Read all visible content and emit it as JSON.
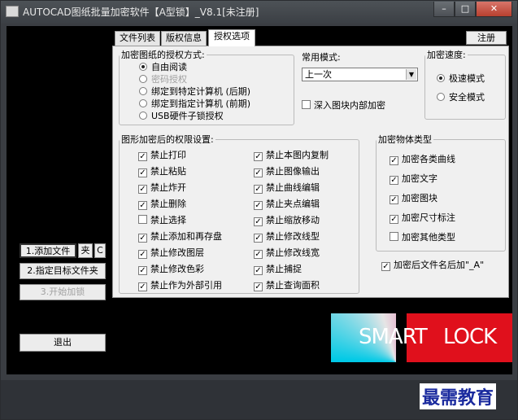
{
  "window": {
    "title": "AUTOCAD图纸批量加密软件【A型锁】_V8.1[未注册]",
    "min_glyph": "–",
    "max_glyph": "□",
    "close_glyph": "✕"
  },
  "tabs": [
    {
      "label": "文件列表",
      "active": false
    },
    {
      "label": "版权信息",
      "active": false
    },
    {
      "label": "授权选项",
      "active": true
    }
  ],
  "register_label": "注册",
  "auth_group": {
    "legend": "加密图纸的授权方式:",
    "options": [
      {
        "label": "自由阅读",
        "selected": true,
        "enabled": true
      },
      {
        "label": "密码授权",
        "selected": false,
        "enabled": false
      },
      {
        "label": "绑定到特定计算机 (后期)",
        "selected": false,
        "enabled": true
      },
      {
        "label": "绑定到指定计算机 (前期)",
        "selected": false,
        "enabled": true
      },
      {
        "label": "USB硬件子锁授权",
        "selected": false,
        "enabled": true
      }
    ]
  },
  "common_mode": {
    "label": "常用模式:",
    "value": "上一次"
  },
  "deep_encrypt": {
    "label": "深入图块内部加密",
    "checked": false
  },
  "speed_group": {
    "legend": "加密速度:",
    "options": [
      {
        "label": "极速模式",
        "selected": true
      },
      {
        "label": "安全模式",
        "selected": false
      }
    ]
  },
  "perm_group": {
    "legend": "图形加密后的权限设置:",
    "col1": [
      {
        "label": "禁止打印",
        "checked": true
      },
      {
        "label": "禁止粘贴",
        "checked": true
      },
      {
        "label": "禁止炸开",
        "checked": true
      },
      {
        "label": "禁止删除",
        "checked": true
      },
      {
        "label": "禁止选择",
        "checked": false
      },
      {
        "label": "禁止添加和再存盘",
        "checked": true
      },
      {
        "label": "禁止修改图层",
        "checked": true
      },
      {
        "label": "禁止修改色彩",
        "checked": true
      },
      {
        "label": "禁止作为外部引用",
        "checked": true
      }
    ],
    "col2": [
      {
        "label": "禁止本图内复制",
        "checked": true
      },
      {
        "label": "禁止图像输出",
        "checked": true
      },
      {
        "label": "禁止曲线编辑",
        "checked": true
      },
      {
        "label": "禁止夹点编辑",
        "checked": true
      },
      {
        "label": "禁止缩放移动",
        "checked": true
      },
      {
        "label": "禁止修改线型",
        "checked": true
      },
      {
        "label": "禁止修改线宽",
        "checked": true
      },
      {
        "label": "禁止捕捉",
        "checked": true
      },
      {
        "label": "禁止查询面积",
        "checked": true
      }
    ]
  },
  "obj_group": {
    "legend": "加密物体类型",
    "items": [
      {
        "label": "加密各类曲线",
        "checked": true
      },
      {
        "label": "加密文字",
        "checked": true
      },
      {
        "label": "加密图块",
        "checked": true
      },
      {
        "label": "加密尺寸标注",
        "checked": true
      },
      {
        "label": "加密其他类型",
        "checked": false
      }
    ]
  },
  "rename": {
    "label": "加密后文件名后加\"_A\"",
    "checked": true
  },
  "left_buttons": {
    "add_files": "1.添加文件",
    "folder": "夹",
    "clear": "C",
    "set_target": "2.指定目标文件夹",
    "start": "3.开始加锁",
    "exit": "退出"
  },
  "logo": {
    "part1": "SMART",
    "part2": "LOCK"
  },
  "watermark": "最需教育"
}
